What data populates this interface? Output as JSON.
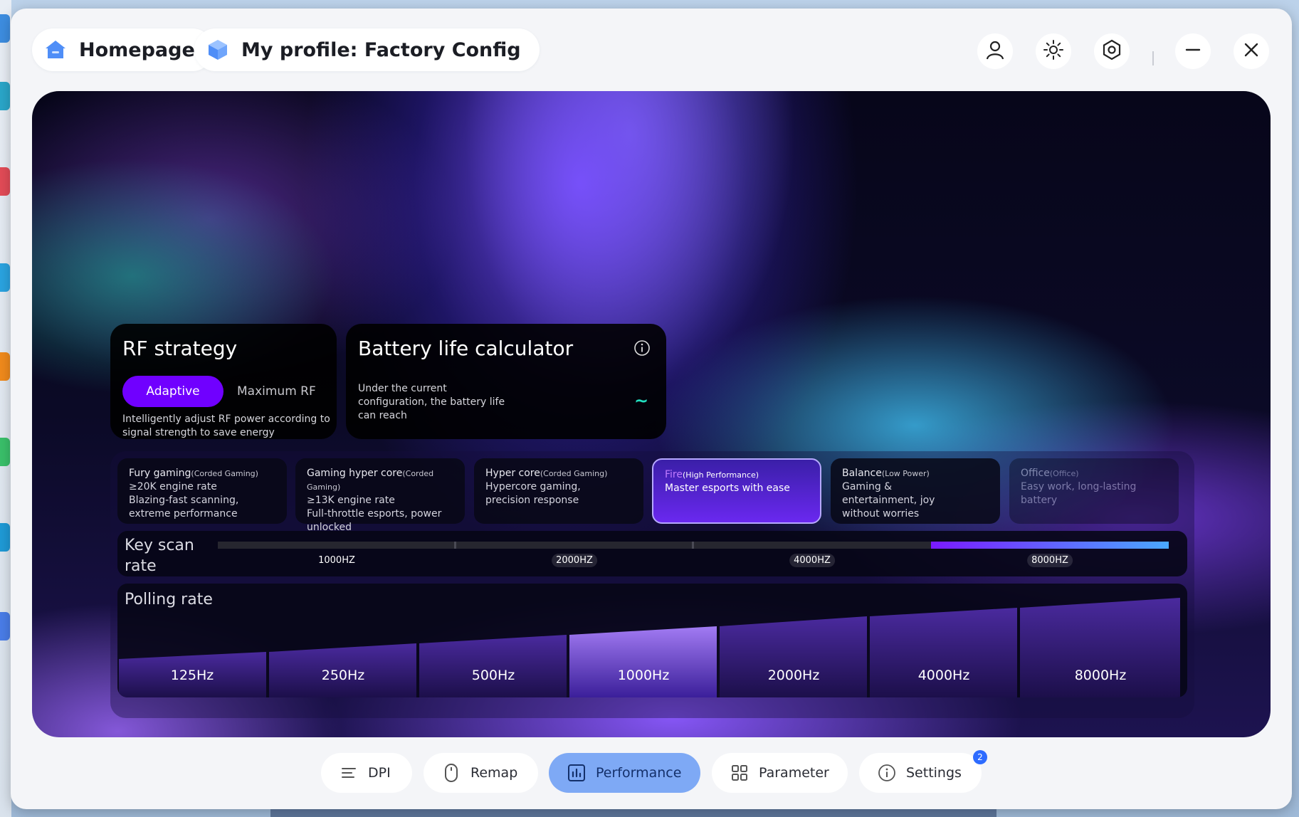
{
  "header": {
    "homepage_label": "Homepage",
    "profile_label": "My profile: Factory Config",
    "icons": [
      "user-icon",
      "brightness-icon",
      "hexagon-settings-icon",
      "minimize-icon",
      "close-icon"
    ]
  },
  "rf_strategy": {
    "title": "RF strategy",
    "options": [
      "Adaptive",
      "Maximum RF"
    ],
    "selected": "Adaptive",
    "description": "Intelligently adjust RF power according to signal strength to save energy"
  },
  "battery": {
    "title": "Battery life calculator",
    "description": "Under the current configuration, the battery life can reach",
    "value": "~"
  },
  "modes": [
    {
      "name": "Fury gaming",
      "note": "(Corded Gaming)",
      "line1": "≥20K engine rate",
      "line2": "Blazing-fast scanning, extreme performance",
      "state": "normal"
    },
    {
      "name": "Gaming hyper core",
      "note": "(Corded Gaming)",
      "line1": "≥13K engine rate",
      "line2": "Full-throttle esports, power unlocked",
      "state": "normal"
    },
    {
      "name": "Hyper core",
      "note": "(Corded Gaming)",
      "line1": "Hypercore gaming, precision response",
      "line2": "",
      "state": "normal"
    },
    {
      "name": "Fire",
      "note": "(High Performance)",
      "line1": "Master esports with ease",
      "line2": "",
      "state": "active"
    },
    {
      "name": "Balance",
      "note": "(Low Power)",
      "line1": "Gaming & entertainment, joy without worries",
      "line2": "",
      "state": "normal"
    },
    {
      "name": "Office",
      "note": "(Office)",
      "line1": "Easy work, long-lasting battery",
      "line2": "",
      "state": "disabled"
    }
  ],
  "key_scan": {
    "label": "Key scan rate",
    "options": [
      "1000HZ",
      "2000HZ",
      "4000HZ",
      "8000HZ"
    ],
    "selected": "8000HZ"
  },
  "polling": {
    "label": "Polling rate",
    "options": [
      "125Hz",
      "250Hz",
      "500Hz",
      "1000Hz",
      "2000Hz",
      "4000Hz",
      "8000Hz"
    ],
    "selected": "1000Hz"
  },
  "nav": {
    "items": [
      "DPI",
      "Remap",
      "Performance",
      "Parameter",
      "Settings"
    ],
    "active": "Performance",
    "settings_badge": "2"
  },
  "colors": {
    "accent": "#7000ff",
    "nav_active": "#7ea9f5",
    "badge": "#2d6bff"
  }
}
